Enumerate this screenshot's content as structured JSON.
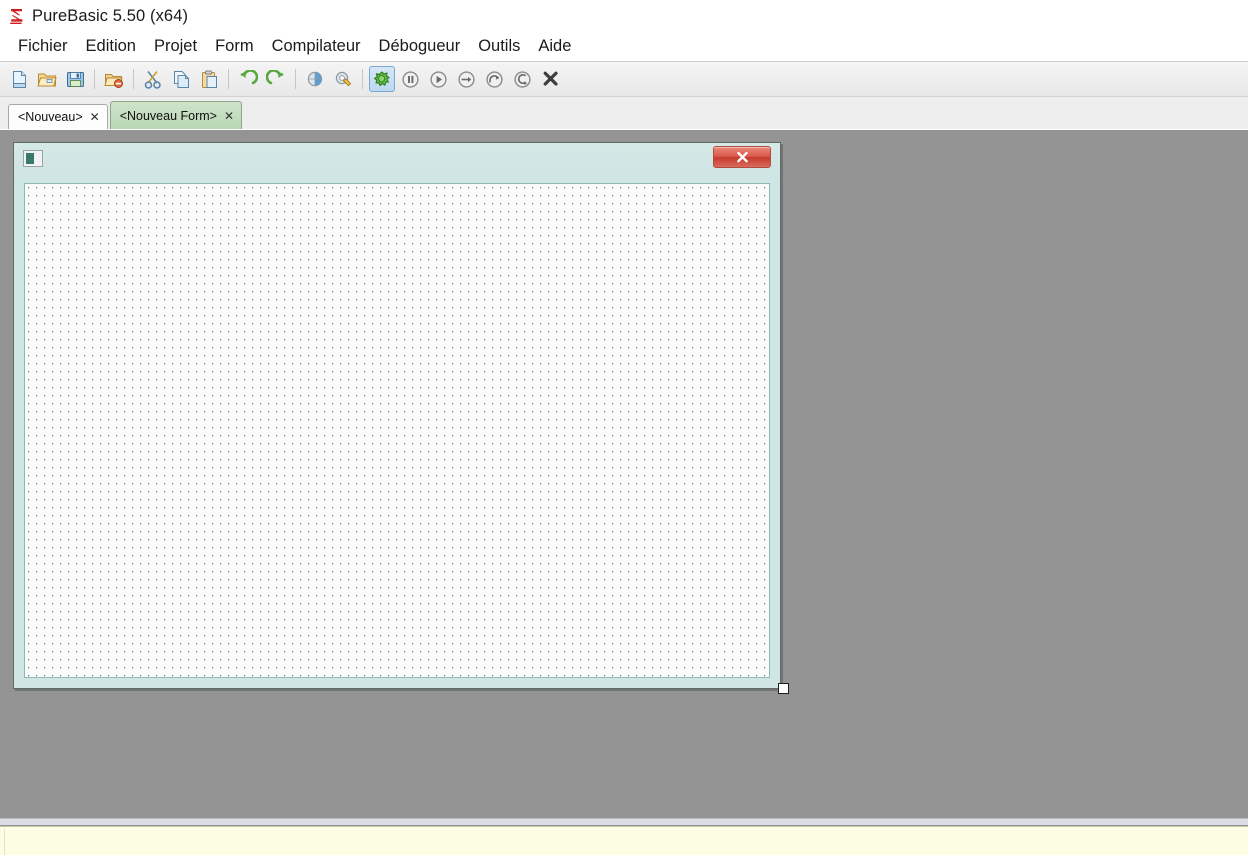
{
  "window": {
    "title": "PureBasic 5.50 (x64)",
    "logo_icon": "purebasic-logo-icon"
  },
  "menubar": {
    "items": [
      {
        "label": "Fichier",
        "name": "menu-fichier"
      },
      {
        "label": "Edition",
        "name": "menu-edition"
      },
      {
        "label": "Projet",
        "name": "menu-projet"
      },
      {
        "label": "Form",
        "name": "menu-form"
      },
      {
        "label": "Compilateur",
        "name": "menu-compilateur"
      },
      {
        "label": "Débogueur",
        "name": "menu-debogueur"
      },
      {
        "label": "Outils",
        "name": "menu-outils"
      },
      {
        "label": "Aide",
        "name": "menu-aide"
      }
    ]
  },
  "toolbar": {
    "buttons": [
      {
        "icon": "new-file-icon",
        "title": "Nouveau"
      },
      {
        "icon": "open-folder-icon",
        "title": "Ouvrir"
      },
      {
        "icon": "save-disk-icon",
        "title": "Enregistrer"
      },
      {
        "separator": true
      },
      {
        "icon": "close-file-icon",
        "title": "Fermer"
      },
      {
        "separator": true
      },
      {
        "icon": "cut-scissors-icon",
        "title": "Couper"
      },
      {
        "icon": "copy-pages-icon",
        "title": "Copier"
      },
      {
        "icon": "paste-clipboard-icon",
        "title": "Coller"
      },
      {
        "separator": true
      },
      {
        "icon": "undo-arrow-icon",
        "title": "Annuler"
      },
      {
        "icon": "redo-arrow-icon",
        "title": "Rétablir"
      },
      {
        "separator": true
      },
      {
        "icon": "compile-globe-icon",
        "title": "Compiler"
      },
      {
        "icon": "build-gear-icon",
        "title": "Créer l'exécutable"
      },
      {
        "separator": true
      },
      {
        "icon": "debug-bug-icon",
        "title": "Débogueur",
        "selected": true
      },
      {
        "icon": "pause-icon",
        "title": "Pause"
      },
      {
        "icon": "run-play-icon",
        "title": "Exécuter"
      },
      {
        "icon": "step-into-icon",
        "title": "Pas à pas détaillé"
      },
      {
        "icon": "step-over-icon",
        "title": "Pas à pas principal"
      },
      {
        "icon": "step-out-icon",
        "title": "Pas à pas sortant"
      },
      {
        "icon": "stop-x-icon",
        "title": "Arrêter"
      }
    ]
  },
  "tabs": [
    {
      "label": "<Nouveau>",
      "active": false,
      "close_glyph": "✕",
      "name": "tab-nouveau"
    },
    {
      "label": "<Nouveau Form>",
      "active": true,
      "close_glyph": "✕",
      "name": "tab-nouveau-form"
    }
  ],
  "form_designer": {
    "window_icon": "form-window-icon",
    "close_button_icon": "close-x-icon",
    "grid": {
      "spacing_px": 8,
      "dot_color": "#6b7f88"
    },
    "canvas_background": "#fbfbfb",
    "titlebar_color": "#cfe5e3",
    "design_area_background": "#949494",
    "resize_handle": "resize-handle-bottom-right"
  },
  "bottom_panel": {
    "text": "",
    "background": "#fdfde4"
  }
}
